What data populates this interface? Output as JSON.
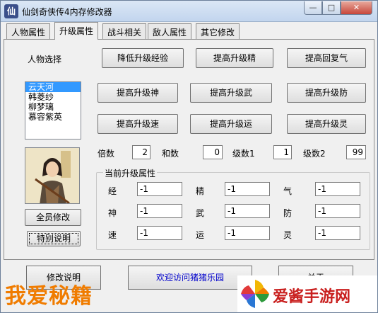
{
  "window": {
    "title": "仙剑奇侠传4内存修改器",
    "app_icon_glyph": "仙",
    "controls": {
      "minimize": "—",
      "maximize": "□",
      "close": "✕"
    }
  },
  "tabs": [
    {
      "label": "人物属性",
      "active": false
    },
    {
      "label": "升级属性",
      "active": true
    },
    {
      "label": "战斗相关",
      "active": false
    },
    {
      "label": "敌人属性",
      "active": false
    },
    {
      "label": "其它修改",
      "active": false
    }
  ],
  "character": {
    "label": "人物选择",
    "list": [
      "云天河",
      "韩菱纱",
      "柳梦璃",
      "慕容紫英"
    ],
    "selected_index": 0
  },
  "action_buttons": [
    [
      "降低升级经验",
      "提高升级精",
      "提高回复气"
    ],
    [
      "提高升级神",
      "提高升级武",
      "提高升级防"
    ],
    [
      "提高升级速",
      "提高升级运",
      "提高升级灵"
    ]
  ],
  "params": {
    "multiplier_label": "倍数",
    "multiplier_value": "2",
    "sum_label": "和数",
    "sum_value": "0",
    "level1_label": "级数1",
    "level1_value": "1",
    "level2_label": "级数2",
    "level2_value": "99"
  },
  "current_attrs": {
    "title": "当前升级属性",
    "rows": [
      [
        {
          "label": "经",
          "value": "-1"
        },
        {
          "label": "精",
          "value": "-1"
        },
        {
          "label": "气",
          "value": "-1"
        }
      ],
      [
        {
          "label": "神",
          "value": "-1"
        },
        {
          "label": "武",
          "value": "-1"
        },
        {
          "label": "防",
          "value": "-1"
        }
      ],
      [
        {
          "label": "速",
          "value": "-1"
        },
        {
          "label": "运",
          "value": "-1"
        },
        {
          "label": "灵",
          "value": "-1"
        }
      ]
    ]
  },
  "side_buttons": {
    "all_modify": "全员修改",
    "special_note": "特别说明"
  },
  "bottom": {
    "modify_note": "修改说明",
    "visit_link": "欢迎访问猪猪乐园",
    "close": "关于"
  },
  "watermarks": {
    "left": "我爱秘籍",
    "right": "爱酱手游网"
  },
  "colors": {
    "selection": "#3399ff",
    "link": "#0000cc",
    "watermark_left": "#f07c00",
    "watermark_right": "#c9201f"
  }
}
